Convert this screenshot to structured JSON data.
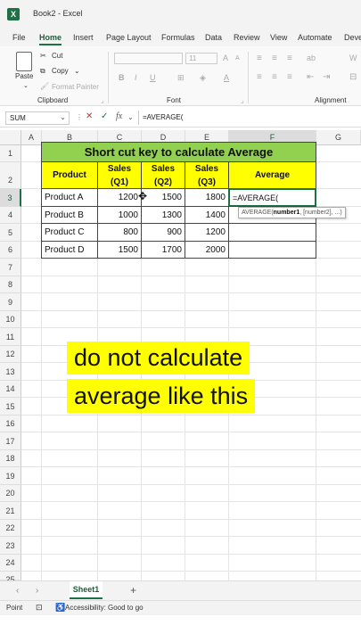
{
  "window": {
    "title": "Book2 - Excel",
    "logo": "X"
  },
  "tabs": [
    "File",
    "Home",
    "Insert",
    "Page Layout",
    "Formulas",
    "Data",
    "Review",
    "View",
    "Automate",
    "Deve"
  ],
  "ribbon": {
    "clipboard": {
      "paste": "Paste",
      "cut": "Cut",
      "copy": "Copy",
      "format_painter": "Format Painter",
      "group_label": "Clipboard"
    },
    "font": {
      "font_size": "11",
      "bold": "B",
      "italic": "I",
      "underline": "U",
      "group_label": "Font",
      "font_color_letter": "A"
    },
    "alignment": {
      "wrap": "W",
      "group_label": "Alignment"
    }
  },
  "formula_bar": {
    "name_box": "SUM",
    "formula": "=AVERAGE(",
    "cancel": "✕",
    "enter": "✓",
    "fx": "fx"
  },
  "columns": [
    "A",
    "B",
    "C",
    "D",
    "E",
    "F",
    "G"
  ],
  "rows": [
    "1",
    "2",
    "3",
    "4",
    "5",
    "6",
    "7",
    "8",
    "9",
    "10",
    "11",
    "12",
    "13",
    "14",
    "15",
    "16",
    "17",
    "18",
    "19",
    "20",
    "21",
    "22",
    "23",
    "24",
    "25"
  ],
  "table": {
    "title": "Short cut key to calculate Average",
    "headers": {
      "product": "Product",
      "q1": {
        "line1": "Sales",
        "line2": "(Q1)"
      },
      "q2": {
        "line1": "Sales",
        "line2": "(Q2)"
      },
      "q3": {
        "line1": "Sales",
        "line2": "(Q3)"
      },
      "average": "Average"
    },
    "rows": [
      {
        "product": "Product A",
        "q1": "1200",
        "q2": "1500",
        "q3": "1800",
        "avg": "=AVERAGE("
      },
      {
        "product": "Product B",
        "q1": "1000",
        "q2": "1300",
        "q3": "1400",
        "avg": ""
      },
      {
        "product": "Product C",
        "q1": "800",
        "q2": "900",
        "q3": "1200",
        "avg": ""
      },
      {
        "product": "Product D",
        "q1": "1500",
        "q2": "1700",
        "q3": "2000",
        "avg": ""
      }
    ]
  },
  "tooltip": {
    "fn": "AVERAGE(",
    "arg1": "number1",
    "rest": ", [number2], ...)"
  },
  "overlay": {
    "line1": "do not calculate",
    "line2": "average like this"
  },
  "sheet": {
    "tab": "Sheet1",
    "add": "+",
    "prev": "‹",
    "next": "›"
  },
  "status": {
    "mode": "Point",
    "accessibility": "Accessibility: Good to go"
  }
}
